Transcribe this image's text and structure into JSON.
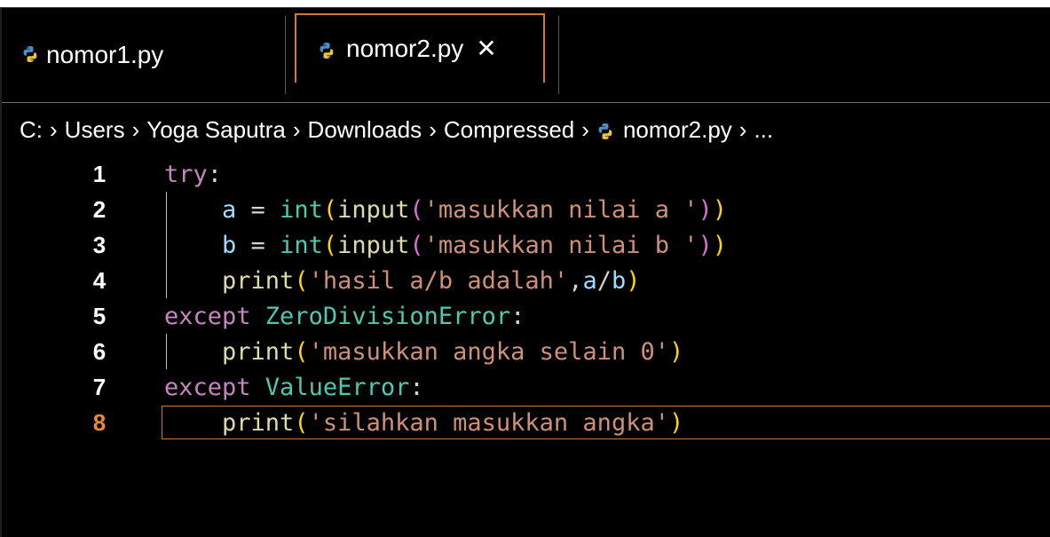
{
  "tabs": [
    {
      "label": "nomor1.py",
      "active": false,
      "icon": "python-icon"
    },
    {
      "label": "nomor2.py",
      "active": true,
      "icon": "python-icon",
      "close": "✕"
    }
  ],
  "breadcrumb": {
    "items": [
      "C:",
      "Users",
      "Yoga Saputra",
      "Downloads",
      "Compressed",
      "nomor2.py",
      "..."
    ],
    "separator": "›"
  },
  "editor": {
    "active_line": 8,
    "lines": [
      {
        "num": "1",
        "tokens": [
          [
            "kw",
            "try"
          ],
          [
            "punc",
            ":"
          ]
        ]
      },
      {
        "num": "2",
        "tokens": [
          [
            "ident",
            "    a "
          ],
          [
            "op",
            "= "
          ],
          [
            "bi",
            "int"
          ],
          [
            "br1",
            "("
          ],
          [
            "fn",
            "input"
          ],
          [
            "br2",
            "("
          ],
          [
            "str",
            "'masukkan nilai a '"
          ],
          [
            "br2",
            ")"
          ],
          [
            "br1",
            ")"
          ]
        ]
      },
      {
        "num": "3",
        "tokens": [
          [
            "ident",
            "    b "
          ],
          [
            "op",
            "= "
          ],
          [
            "bi",
            "int"
          ],
          [
            "br1",
            "("
          ],
          [
            "fn",
            "input"
          ],
          [
            "br2",
            "("
          ],
          [
            "str",
            "'masukkan nilai b '"
          ],
          [
            "br2",
            ")"
          ],
          [
            "br1",
            ")"
          ]
        ]
      },
      {
        "num": "4",
        "tokens": [
          [
            "fn",
            "    print"
          ],
          [
            "br1",
            "("
          ],
          [
            "str",
            "'hasil a/b adalah'"
          ],
          [
            "punc",
            ","
          ],
          [
            "ident",
            "a"
          ],
          [
            "op",
            "/"
          ],
          [
            "ident",
            "b"
          ],
          [
            "br1",
            ")"
          ]
        ]
      },
      {
        "num": "5",
        "tokens": [
          [
            "kw",
            "except "
          ],
          [
            "cls",
            "ZeroDivisionError"
          ],
          [
            "punc",
            ":"
          ]
        ]
      },
      {
        "num": "6",
        "tokens": [
          [
            "fn",
            "    print"
          ],
          [
            "br1",
            "("
          ],
          [
            "str",
            "'masukkan angka selain 0'"
          ],
          [
            "br1",
            ")"
          ]
        ]
      },
      {
        "num": "7",
        "tokens": [
          [
            "kw",
            "except "
          ],
          [
            "cls",
            "ValueError"
          ],
          [
            "punc",
            ":"
          ]
        ]
      },
      {
        "num": "8",
        "tokens": [
          [
            "fn",
            "    print"
          ],
          [
            "br1",
            "("
          ],
          [
            "str",
            "'silahkan masukkan angka'"
          ],
          [
            "br1",
            ")"
          ]
        ]
      }
    ]
  },
  "colors": {
    "background": "#000000",
    "accent_border": "#d07a2e",
    "active_line_number": "#e8893a"
  }
}
